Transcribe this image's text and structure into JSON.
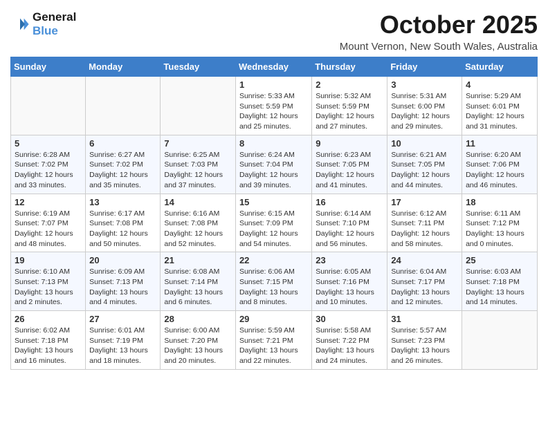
{
  "header": {
    "logo_line1": "General",
    "logo_line2": "Blue",
    "month": "October 2025",
    "location": "Mount Vernon, New South Wales, Australia"
  },
  "weekdays": [
    "Sunday",
    "Monday",
    "Tuesday",
    "Wednesday",
    "Thursday",
    "Friday",
    "Saturday"
  ],
  "weeks": [
    [
      {
        "day": "",
        "info": ""
      },
      {
        "day": "",
        "info": ""
      },
      {
        "day": "",
        "info": ""
      },
      {
        "day": "1",
        "info": "Sunrise: 5:33 AM\nSunset: 5:59 PM\nDaylight: 12 hours\nand 25 minutes."
      },
      {
        "day": "2",
        "info": "Sunrise: 5:32 AM\nSunset: 5:59 PM\nDaylight: 12 hours\nand 27 minutes."
      },
      {
        "day": "3",
        "info": "Sunrise: 5:31 AM\nSunset: 6:00 PM\nDaylight: 12 hours\nand 29 minutes."
      },
      {
        "day": "4",
        "info": "Sunrise: 5:29 AM\nSunset: 6:01 PM\nDaylight: 12 hours\nand 31 minutes."
      }
    ],
    [
      {
        "day": "5",
        "info": "Sunrise: 6:28 AM\nSunset: 7:02 PM\nDaylight: 12 hours\nand 33 minutes."
      },
      {
        "day": "6",
        "info": "Sunrise: 6:27 AM\nSunset: 7:02 PM\nDaylight: 12 hours\nand 35 minutes."
      },
      {
        "day": "7",
        "info": "Sunrise: 6:25 AM\nSunset: 7:03 PM\nDaylight: 12 hours\nand 37 minutes."
      },
      {
        "day": "8",
        "info": "Sunrise: 6:24 AM\nSunset: 7:04 PM\nDaylight: 12 hours\nand 39 minutes."
      },
      {
        "day": "9",
        "info": "Sunrise: 6:23 AM\nSunset: 7:05 PM\nDaylight: 12 hours\nand 41 minutes."
      },
      {
        "day": "10",
        "info": "Sunrise: 6:21 AM\nSunset: 7:05 PM\nDaylight: 12 hours\nand 44 minutes."
      },
      {
        "day": "11",
        "info": "Sunrise: 6:20 AM\nSunset: 7:06 PM\nDaylight: 12 hours\nand 46 minutes."
      }
    ],
    [
      {
        "day": "12",
        "info": "Sunrise: 6:19 AM\nSunset: 7:07 PM\nDaylight: 12 hours\nand 48 minutes."
      },
      {
        "day": "13",
        "info": "Sunrise: 6:17 AM\nSunset: 7:08 PM\nDaylight: 12 hours\nand 50 minutes."
      },
      {
        "day": "14",
        "info": "Sunrise: 6:16 AM\nSunset: 7:08 PM\nDaylight: 12 hours\nand 52 minutes."
      },
      {
        "day": "15",
        "info": "Sunrise: 6:15 AM\nSunset: 7:09 PM\nDaylight: 12 hours\nand 54 minutes."
      },
      {
        "day": "16",
        "info": "Sunrise: 6:14 AM\nSunset: 7:10 PM\nDaylight: 12 hours\nand 56 minutes."
      },
      {
        "day": "17",
        "info": "Sunrise: 6:12 AM\nSunset: 7:11 PM\nDaylight: 12 hours\nand 58 minutes."
      },
      {
        "day": "18",
        "info": "Sunrise: 6:11 AM\nSunset: 7:12 PM\nDaylight: 13 hours\nand 0 minutes."
      }
    ],
    [
      {
        "day": "19",
        "info": "Sunrise: 6:10 AM\nSunset: 7:13 PM\nDaylight: 13 hours\nand 2 minutes."
      },
      {
        "day": "20",
        "info": "Sunrise: 6:09 AM\nSunset: 7:13 PM\nDaylight: 13 hours\nand 4 minutes."
      },
      {
        "day": "21",
        "info": "Sunrise: 6:08 AM\nSunset: 7:14 PM\nDaylight: 13 hours\nand 6 minutes."
      },
      {
        "day": "22",
        "info": "Sunrise: 6:06 AM\nSunset: 7:15 PM\nDaylight: 13 hours\nand 8 minutes."
      },
      {
        "day": "23",
        "info": "Sunrise: 6:05 AM\nSunset: 7:16 PM\nDaylight: 13 hours\nand 10 minutes."
      },
      {
        "day": "24",
        "info": "Sunrise: 6:04 AM\nSunset: 7:17 PM\nDaylight: 13 hours\nand 12 minutes."
      },
      {
        "day": "25",
        "info": "Sunrise: 6:03 AM\nSunset: 7:18 PM\nDaylight: 13 hours\nand 14 minutes."
      }
    ],
    [
      {
        "day": "26",
        "info": "Sunrise: 6:02 AM\nSunset: 7:18 PM\nDaylight: 13 hours\nand 16 minutes."
      },
      {
        "day": "27",
        "info": "Sunrise: 6:01 AM\nSunset: 7:19 PM\nDaylight: 13 hours\nand 18 minutes."
      },
      {
        "day": "28",
        "info": "Sunrise: 6:00 AM\nSunset: 7:20 PM\nDaylight: 13 hours\nand 20 minutes."
      },
      {
        "day": "29",
        "info": "Sunrise: 5:59 AM\nSunset: 7:21 PM\nDaylight: 13 hours\nand 22 minutes."
      },
      {
        "day": "30",
        "info": "Sunrise: 5:58 AM\nSunset: 7:22 PM\nDaylight: 13 hours\nand 24 minutes."
      },
      {
        "day": "31",
        "info": "Sunrise: 5:57 AM\nSunset: 7:23 PM\nDaylight: 13 hours\nand 26 minutes."
      },
      {
        "day": "",
        "info": ""
      }
    ]
  ]
}
